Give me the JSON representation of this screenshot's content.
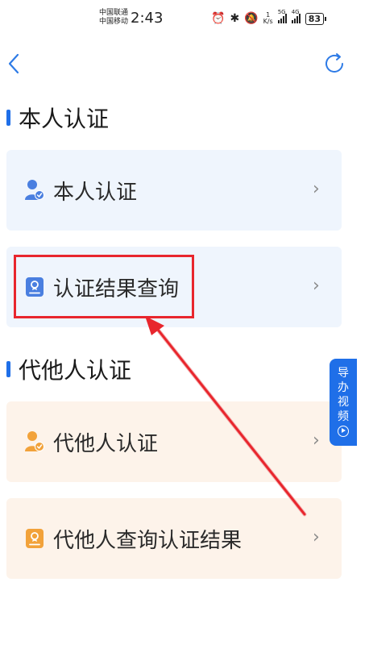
{
  "status_bar": {
    "carrier_1": "中国联通",
    "carrier_2": "中国移动",
    "time": "2:43",
    "speed_value": "1",
    "speed_unit": "K/s",
    "network_1": "5G",
    "network_2": "4G",
    "battery": "83"
  },
  "nav": {
    "back_icon": "chevron-left-icon",
    "refresh_icon": "refresh-icon"
  },
  "sections": [
    {
      "title": "本人认证",
      "items": [
        {
          "label": "本人认证",
          "icon": "person-verified-icon",
          "color": "#4a7fe0"
        },
        {
          "label": "认证结果查询",
          "icon": "certificate-icon",
          "color": "#4a7fe0"
        }
      ]
    },
    {
      "title": "代他人认证",
      "items": [
        {
          "label": "代他人认证",
          "icon": "person-verified-icon",
          "color": "#f2a23a"
        },
        {
          "label": "代他人查询认证结果",
          "icon": "certificate-icon",
          "color": "#f2a23a"
        }
      ]
    }
  ],
  "guide_tab": {
    "label": "导办视频",
    "icon": "play-circle-icon"
  },
  "colors": {
    "accent": "#1f6fe8",
    "annotation": "#e8262d",
    "blue_card": "#eff5fd",
    "orange_card": "#fdf3ea"
  }
}
